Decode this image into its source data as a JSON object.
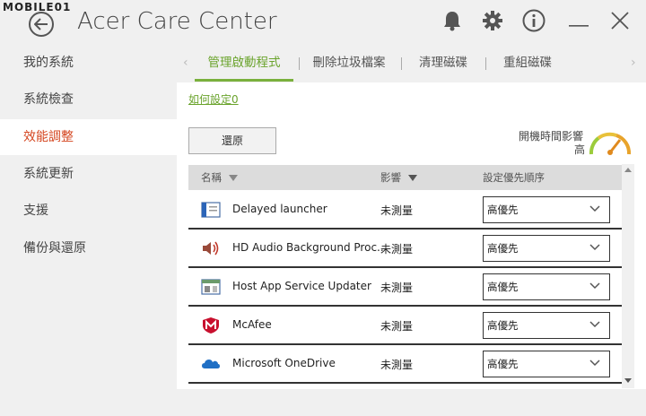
{
  "window": {
    "watermark": "MOBILE01",
    "title": "Acer Care Center"
  },
  "sidebar": {
    "items": [
      {
        "label": "我的系統",
        "active": false
      },
      {
        "label": "系統檢查",
        "active": false
      },
      {
        "label": "效能調整",
        "active": true
      },
      {
        "label": "系統更新",
        "active": false
      },
      {
        "label": "支援",
        "active": false
      },
      {
        "label": "備份與還原",
        "active": false
      }
    ]
  },
  "tabs": [
    {
      "label": "管理啟動程式",
      "active": true
    },
    {
      "label": "刪除垃圾檔案",
      "active": false
    },
    {
      "label": "清理磁碟",
      "active": false
    },
    {
      "label": "重組磁碟",
      "active": false
    }
  ],
  "main": {
    "help_link": "如何設定0",
    "restore_button": "還原",
    "boot_impact_label": "開機時間影響",
    "boot_impact_value": "高"
  },
  "table": {
    "columns": [
      "名稱",
      "影響",
      "設定優先順序"
    ],
    "rows": [
      {
        "icon": "app-window-icon",
        "name": "Delayed launcher",
        "impact": "未測量",
        "priority": "高優先"
      },
      {
        "icon": "speaker-icon",
        "name": "HD Audio Background Proc..",
        "impact": "未測量",
        "priority": "高優先"
      },
      {
        "icon": "app-window-icon",
        "name": "Host App Service Updater",
        "impact": "未測量",
        "priority": "高優先"
      },
      {
        "icon": "mcafee-icon",
        "name": "McAfee",
        "impact": "未測量",
        "priority": "高優先"
      },
      {
        "icon": "cloud-icon",
        "name": "Microsoft OneDrive",
        "impact": "未測量",
        "priority": "高優先"
      }
    ]
  },
  "colors": {
    "accent_green": "#7ab03c",
    "active_sidebar_text": "#d4451f",
    "mcafee_red": "#c8102e",
    "onedrive_blue": "#1f6fc5"
  }
}
